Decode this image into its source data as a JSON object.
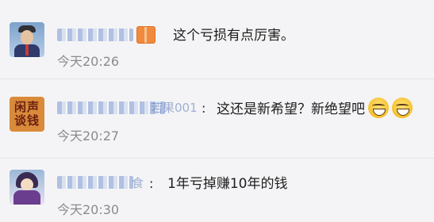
{
  "comments": [
    {
      "colon": ":",
      "text": "这个亏损有点厉害。",
      "time": "今天20:26"
    },
    {
      "name_tail": "若果001",
      "colon": ":",
      "text": "这还是新希望？新绝望吧",
      "time": "今天20:27",
      "emojis": [
        "laughing-crying-emoji",
        "laughing-crying-emoji"
      ]
    },
    {
      "name_tail": "食",
      "colon": ":",
      "text": "1年亏掉赚10年的钱",
      "time": "今天20:30"
    }
  ],
  "avatar_b_text": "闲声\n谈钱"
}
